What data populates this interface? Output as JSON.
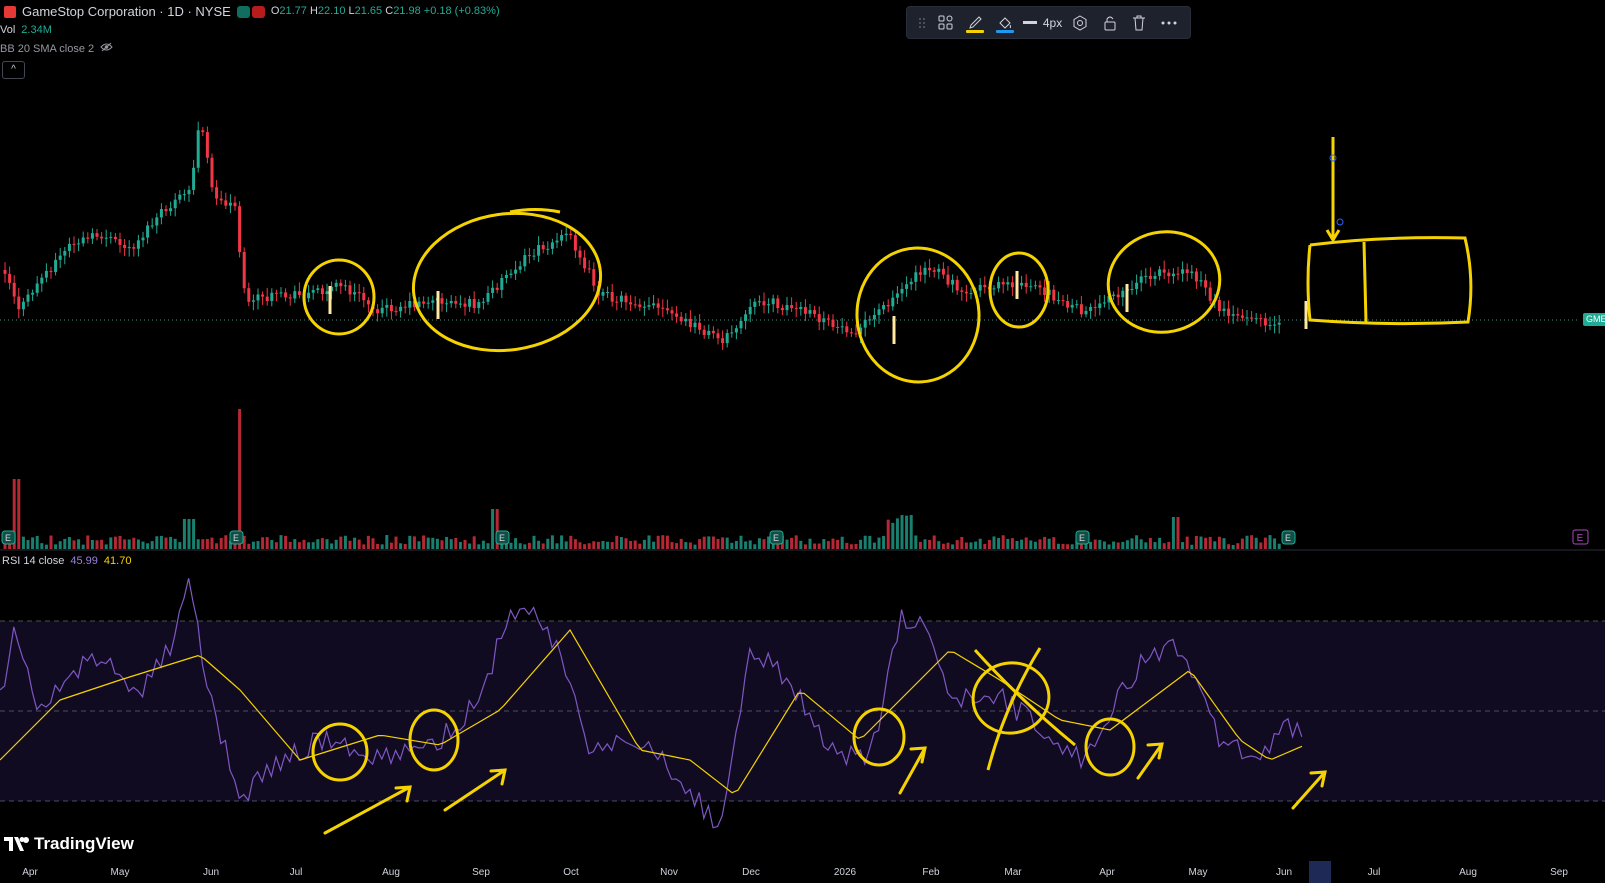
{
  "legend": {
    "title": "GameStop Corporation · 1D · NYSE",
    "ohlc": [
      {
        "k": "O",
        "v": "21.77"
      },
      {
        "k": "H",
        "v": "22.10"
      },
      {
        "k": "L",
        "v": "21.65"
      },
      {
        "k": "C",
        "v": "21.98"
      }
    ],
    "change": "+0.18 (+0.83%)",
    "vol_label": "Vol",
    "vol_value": "2.34M",
    "bb_label": "BB 20 SMA close 2",
    "collapse_icon": "^"
  },
  "toolbar": {
    "width_label": "4px",
    "highlight_color": "#f5d300",
    "fill_color": "#2196f3"
  },
  "rsi": {
    "label": "RSI 14 close",
    "value1": "45.99",
    "value2": "41.70",
    "upper": 70,
    "lower": 30,
    "mid": 50
  },
  "price_tag": "GME",
  "brand": "TradingView",
  "x_axis": [
    "Apr",
    "May",
    "Jun",
    "Jul",
    "Aug",
    "Sep",
    "Oct",
    "Nov",
    "Dec",
    "2026",
    "Feb",
    "Mar",
    "Apr",
    "May",
    "Jun",
    "",
    "Jul",
    "Aug",
    "Sep"
  ],
  "colors": {
    "up": "#22ab94",
    "down": "#f23645",
    "annotation": "#f5d300",
    "rsi": "#7e57c2",
    "rsi_ma": "#f5d300"
  }
}
